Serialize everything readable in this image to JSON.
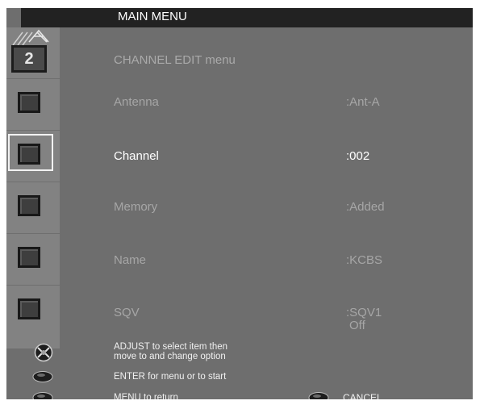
{
  "main_menu_title": "MAIN MENU",
  "channel_number": "2",
  "menu_title": "CHANNEL EDIT menu",
  "items": [
    {
      "label": "Antenna",
      "value": ":Ant-A",
      "value2": ""
    },
    {
      "label": "Channel",
      "value": ":002",
      "value2": ""
    },
    {
      "label": "Memory",
      "value": ":Added",
      "value2": ""
    },
    {
      "label": "Name",
      "value": ":KCBS",
      "value2": ""
    },
    {
      "label": "SQV",
      "value": ":SQV1",
      "value2": "Off"
    }
  ],
  "help": {
    "adjust_line1": "ADJUST to select item then",
    "adjust_line2": "move to and change option",
    "enter": "ENTER for menu or to start",
    "menu": "MENU to return",
    "cancel": "CANCEL"
  },
  "colors": {
    "background": "#6e6e6e",
    "title_bar": "#222222",
    "selected_text": "#ffffff",
    "dim_text": "#a6a6a6"
  }
}
